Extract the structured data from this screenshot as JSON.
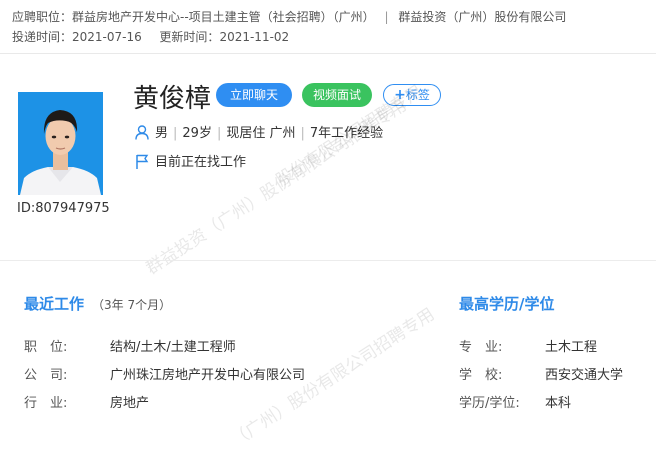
{
  "header": {
    "position_label": "应聘职位：",
    "position_value": "群益房地产开发中心--项目土建主管（社会招聘）（广州）",
    "company": "群益投资（广州）股份有限公司",
    "separator": "|",
    "delivered_label": "投递时间：",
    "delivered_value": "2021-07-16",
    "updated_label": "更新时间：",
    "updated_value": "2021-11-02"
  },
  "profile": {
    "name": "黄俊樟",
    "id_text": "ID:807947975",
    "chat_button": "立即聊天",
    "video_button": "视频面试",
    "tag_button": "标签",
    "gender": "男",
    "age": "29岁",
    "location": "现居住 广州",
    "experience": "7年工作经验",
    "job_status": "目前正在找工作"
  },
  "recent_work": {
    "title": "最近工作",
    "duration": "（3年 7个月）",
    "position_label": "职　位:",
    "position_value": "结构/土木/土建工程师",
    "company_label": "公　司:",
    "company_value": "广州珠江房地产开发中心有限公司",
    "industry_label": "行　业:",
    "industry_value": "房地产"
  },
  "education": {
    "title": "最高学历/学位",
    "major_label": "专　业:",
    "major_value": "土木工程",
    "school_label": "学　校:",
    "school_value": "西安交通大学",
    "degree_label": "学历/学位:",
    "degree_value": "本科"
  },
  "watermark": {
    "line1": "群益投资（广州）股份有限公司招聘专用",
    "line2": "股份有限公司招聘专用",
    "line3": "（广州）股份有限公司招聘专用"
  },
  "colors": {
    "accent": "#2e8ae8",
    "chat": "#2f8ef2",
    "video": "#3ac35f",
    "avatar_bg": "#1d92e6"
  }
}
